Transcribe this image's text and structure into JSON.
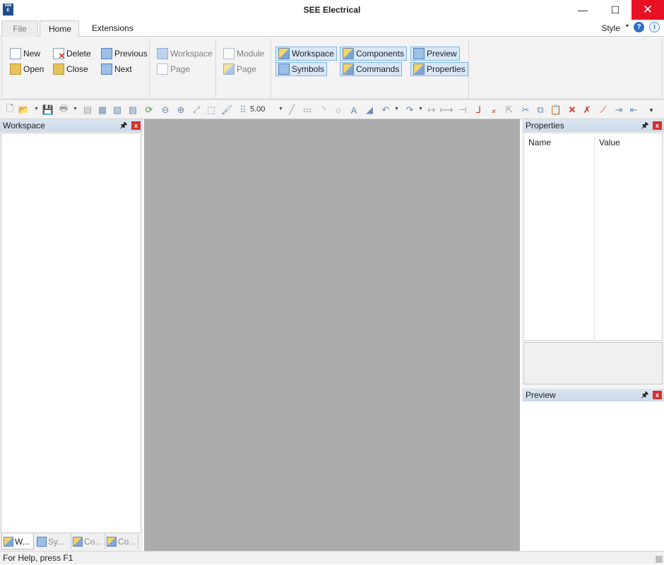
{
  "window": {
    "title": "SEE Electrical",
    "app_icon_text": "see E",
    "minimize": "—",
    "maximize": "☐",
    "close": "✕"
  },
  "ribbon_tabs": [
    {
      "label": "File",
      "active": false
    },
    {
      "label": "Home",
      "active": true
    },
    {
      "label": "Extensions",
      "active": false
    }
  ],
  "top_right": {
    "style_label": "Style",
    "caret": "▾",
    "help": "?",
    "info": "i"
  },
  "ribbon": {
    "project_group": [
      {
        "label": "New",
        "icon": "new-document-icon",
        "enabled": true
      },
      {
        "label": "Open",
        "icon": "open-folder-icon",
        "enabled": true
      },
      {
        "label": "Delete",
        "icon": "delete-document-icon",
        "enabled": true
      },
      {
        "label": "Close",
        "icon": "close-folder-icon",
        "enabled": true
      },
      {
        "label": "Previous",
        "icon": "previous-page-icon",
        "enabled": true
      },
      {
        "label": "Next",
        "icon": "next-page-icon",
        "enabled": true
      }
    ],
    "info_group": [
      {
        "label": "Workspace",
        "icon": "workspace-info-icon",
        "enabled": false
      },
      {
        "label": "Page",
        "icon": "page-info-icon",
        "enabled": false
      }
    ],
    "module_group": [
      {
        "label": "Module",
        "icon": "module-icon",
        "enabled": false
      },
      {
        "label": "Page",
        "icon": "page-icon",
        "enabled": false
      }
    ],
    "window_group": [
      {
        "label": "Workspace",
        "icon": "workspace-window-icon",
        "selected": true
      },
      {
        "label": "Symbols",
        "icon": "symbols-icon",
        "selected": true
      },
      {
        "label": "Components",
        "icon": "components-icon",
        "selected": true
      },
      {
        "label": "Commands",
        "icon": "commands-icon",
        "selected": true
      },
      {
        "label": "Preview",
        "icon": "preview-icon",
        "selected": true
      },
      {
        "label": "Properties",
        "icon": "properties-icon",
        "selected": true
      }
    ]
  },
  "toolbar": {
    "grid_value": "5.00",
    "buttons": [
      "new",
      "open",
      "save",
      "print",
      "print-preview",
      "page-prev",
      "page-next",
      "page-props",
      "refresh",
      "zoom-out",
      "zoom-in",
      "zoom-fit",
      "zoom-window",
      "paint",
      "grid",
      "line",
      "rectangle",
      "arc",
      "circle",
      "text",
      "text-style",
      "undo",
      "redo",
      "dimension",
      "dimension-h",
      "dimension-v",
      "wire",
      "cross",
      "select",
      "cut",
      "copy",
      "paste",
      "delete",
      "delete-all",
      "trim",
      "break-h",
      "break-v",
      "more"
    ]
  },
  "workspace_panel": {
    "title": "Workspace",
    "pin": "📌",
    "close": "x",
    "bottom_tabs": [
      {
        "label": "W...",
        "icon": "workspace-tab-icon",
        "active": true
      },
      {
        "label": "Sy...",
        "icon": "symbols-tab-icon",
        "active": false
      },
      {
        "label": "Co...",
        "icon": "components-tab-icon",
        "active": false
      },
      {
        "label": "Co...",
        "icon": "commands-tab-icon",
        "active": false
      }
    ]
  },
  "properties_panel": {
    "title": "Properties",
    "close": "x",
    "columns": [
      "Name",
      "Value"
    ]
  },
  "preview_panel": {
    "title": "Preview",
    "close": "x"
  },
  "status": {
    "text": "For Help, press F1"
  }
}
